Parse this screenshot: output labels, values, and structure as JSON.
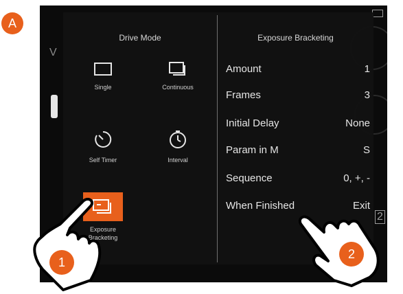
{
  "badges": {
    "figure_label": "A",
    "step1": "1",
    "step2": "2"
  },
  "background": {
    "letter": "V",
    "tag": "2",
    "battery_icon": "battery-icon"
  },
  "drive_mode": {
    "title": "Drive Mode",
    "modes": [
      {
        "label": "Single",
        "icon": "single-shot-icon"
      },
      {
        "label": "Continuous",
        "icon": "continuous-shot-icon"
      },
      {
        "label": "Self Timer",
        "icon": "self-timer-icon"
      },
      {
        "label": "Interval",
        "icon": "interval-icon"
      },
      {
        "label_line1": "Exposure",
        "label_line2": "Bracketing",
        "icon": "exposure-bracketing-icon",
        "selected": true
      }
    ]
  },
  "exposure_bracketing": {
    "title": "Exposure Bracketing",
    "rows": [
      {
        "label": "Amount",
        "value": "1"
      },
      {
        "label": "Frames",
        "value": "3"
      },
      {
        "label": "Initial Delay",
        "value": "None"
      },
      {
        "label": "Param in M",
        "value": "S"
      },
      {
        "label": "Sequence",
        "value": "0, +, -"
      },
      {
        "label": "When Finished",
        "value": "Exit"
      }
    ]
  },
  "colors": {
    "accent": "#e8601c",
    "panel": "#121212",
    "text": "#e6e6e6"
  }
}
